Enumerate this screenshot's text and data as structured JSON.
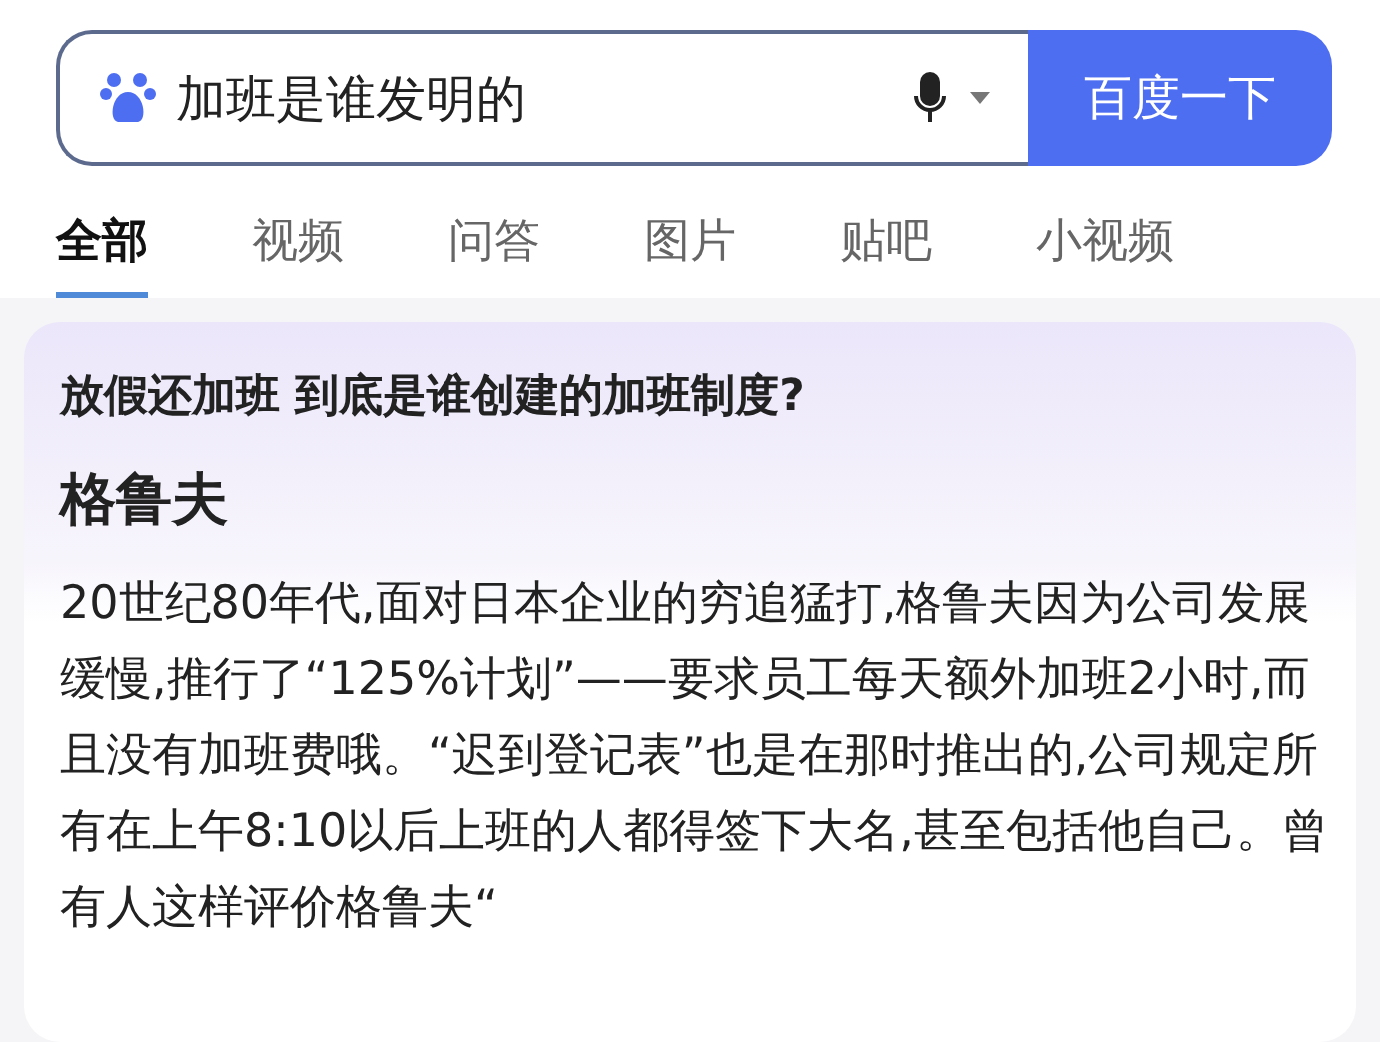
{
  "search": {
    "value": "加班是谁发明的",
    "button": "百度一下"
  },
  "tabs": [
    {
      "label": "全部",
      "selected": true
    },
    {
      "label": "视频",
      "selected": false
    },
    {
      "label": "问答",
      "selected": false
    },
    {
      "label": "图片",
      "selected": false
    },
    {
      "label": "贴吧",
      "selected": false
    },
    {
      "label": "小视频",
      "selected": false
    }
  ],
  "answer": {
    "question": "放假还加班 到底是谁创建的加班制度?",
    "answer": "格鲁夫",
    "body": "20世纪80年代,面对日本企业的穷追猛打,格鲁夫因为公司发展缓慢,推行了“125%计划”——要求员工每天额外加班2小时,而且没有加班费哦。“迟到登记表”也是在那时推出的,公司规定所有在上午8:10以后上班的人都得签下大名,甚至包括他自己。曾有人这样评价格鲁夫“"
  }
}
